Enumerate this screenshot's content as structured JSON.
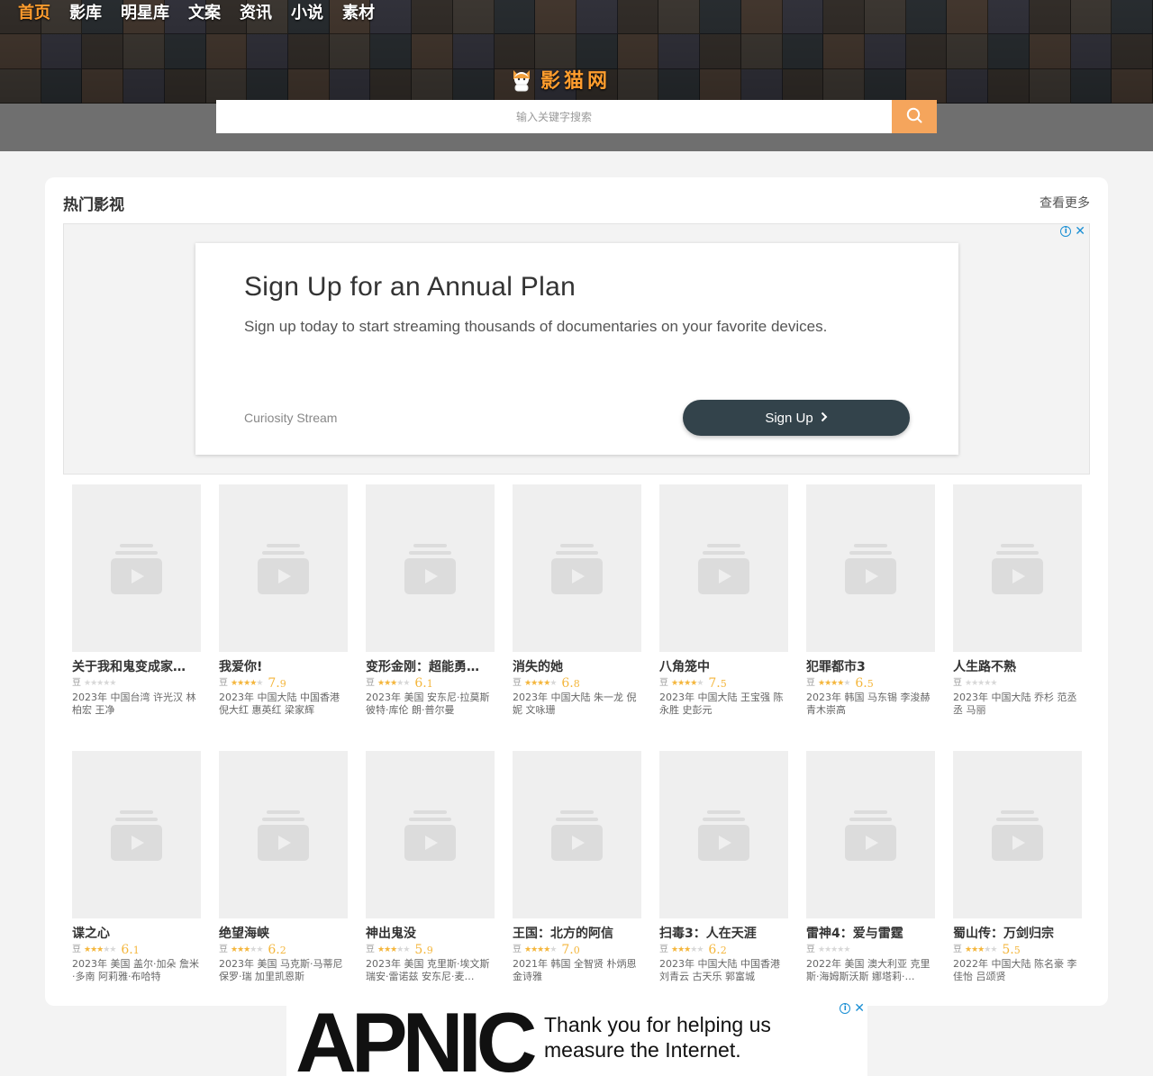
{
  "header": {
    "nav": [
      {
        "label": "首页",
        "active": true
      },
      {
        "label": "影库",
        "active": false
      },
      {
        "label": "明星库",
        "active": false
      },
      {
        "label": "文案",
        "active": false
      },
      {
        "label": "资讯",
        "active": false
      },
      {
        "label": "小说",
        "active": false
      },
      {
        "label": "素材",
        "active": false
      }
    ],
    "logo_text": "影猫网",
    "brand_color": "#ff9d2e"
  },
  "search": {
    "placeholder": "输入关键字搜索",
    "button_icon": "search-icon",
    "button_color": "#f5a55c"
  },
  "section": {
    "title": "热门影视",
    "more_label": "查看更多"
  },
  "ad": {
    "headline": "Sign Up for an Annual Plan",
    "description": "Sign up today to start streaming thousands of documentaries on your favorite devices.",
    "brand": "Curiosity Stream",
    "cta_label": "Sign Up",
    "info_icon": "info-icon",
    "close_icon": "close-icon"
  },
  "movies": [
    {
      "title": "关于我和鬼变成家…",
      "rating_stars": 0,
      "score": "",
      "meta": "2023年 中国台湾 许光汉 林柏宏 王净"
    },
    {
      "title": "我爱你!",
      "rating_stars": 4,
      "score": "7.9",
      "meta": "2023年 中国大陆 中国香港 倪大红 惠英红 梁家辉"
    },
    {
      "title": "变形金刚：超能勇…",
      "rating_stars": 3,
      "score": "6.1",
      "meta": "2023年 美国 安东尼·拉莫斯 彼特·库伦 朗·普尔曼"
    },
    {
      "title": "消失的她",
      "rating_stars": 3.5,
      "score": "6.8",
      "meta": "2023年 中国大陆 朱一龙 倪妮 文咏珊"
    },
    {
      "title": "八角笼中",
      "rating_stars": 4,
      "score": "7.5",
      "meta": "2023年 中国大陆 王宝强 陈永胜 史彭元"
    },
    {
      "title": "犯罪都市3",
      "rating_stars": 3.5,
      "score": "6.5",
      "meta": "2023年 韩国 马东锡 李浚赫 青木崇高"
    },
    {
      "title": "人生路不熟",
      "rating_stars": 0,
      "score": "",
      "meta": "2023年 中国大陆 乔杉 范丞丞 马丽"
    },
    {
      "title": "谍之心",
      "rating_stars": 3,
      "score": "6.1",
      "meta": "2023年 美国 盖尔·加朵 詹米·多南 阿莉雅·布哈特"
    },
    {
      "title": "绝望海峡",
      "rating_stars": 3,
      "score": "6.2",
      "meta": "2023年 美国 马克斯·马蒂尼 保罗·瑞 加里凯恩斯"
    },
    {
      "title": "神出鬼没",
      "rating_stars": 3,
      "score": "5.9",
      "meta": "2023年 美国 克里斯·埃文斯 瑞安·雷诺兹 安东尼·麦…"
    },
    {
      "title": "王国：北方的阿信",
      "rating_stars": 3.5,
      "score": "7.0",
      "meta": "2021年 韩国 全智贤 朴炳恩 金诗雅"
    },
    {
      "title": "扫毒3：人在天涯",
      "rating_stars": 3,
      "score": "6.2",
      "meta": "2023年 中国大陆 中国香港 刘青云 古天乐 郭富城"
    },
    {
      "title": "雷神4：爱与雷霆",
      "rating_stars": 0,
      "score": "",
      "meta": "2022年 美国 澳大利亚 克里斯·海姆斯沃斯 娜塔莉·…"
    },
    {
      "title": "蜀山传：万剑归宗",
      "rating_stars": 3,
      "score": "5.5",
      "meta": "2022年 中国大陆 陈名豪 李佳怡 吕颂贤"
    }
  ],
  "movie_card": {
    "douban_label": "豆",
    "placeholder_icon": "video-placeholder-icon",
    "star_color": "#f4b63c"
  },
  "bottom_ad": {
    "logo": "APNIC",
    "text": "Thank you for helping us measure the Internet.",
    "info_icon": "info-icon",
    "close_icon": "close-icon"
  }
}
